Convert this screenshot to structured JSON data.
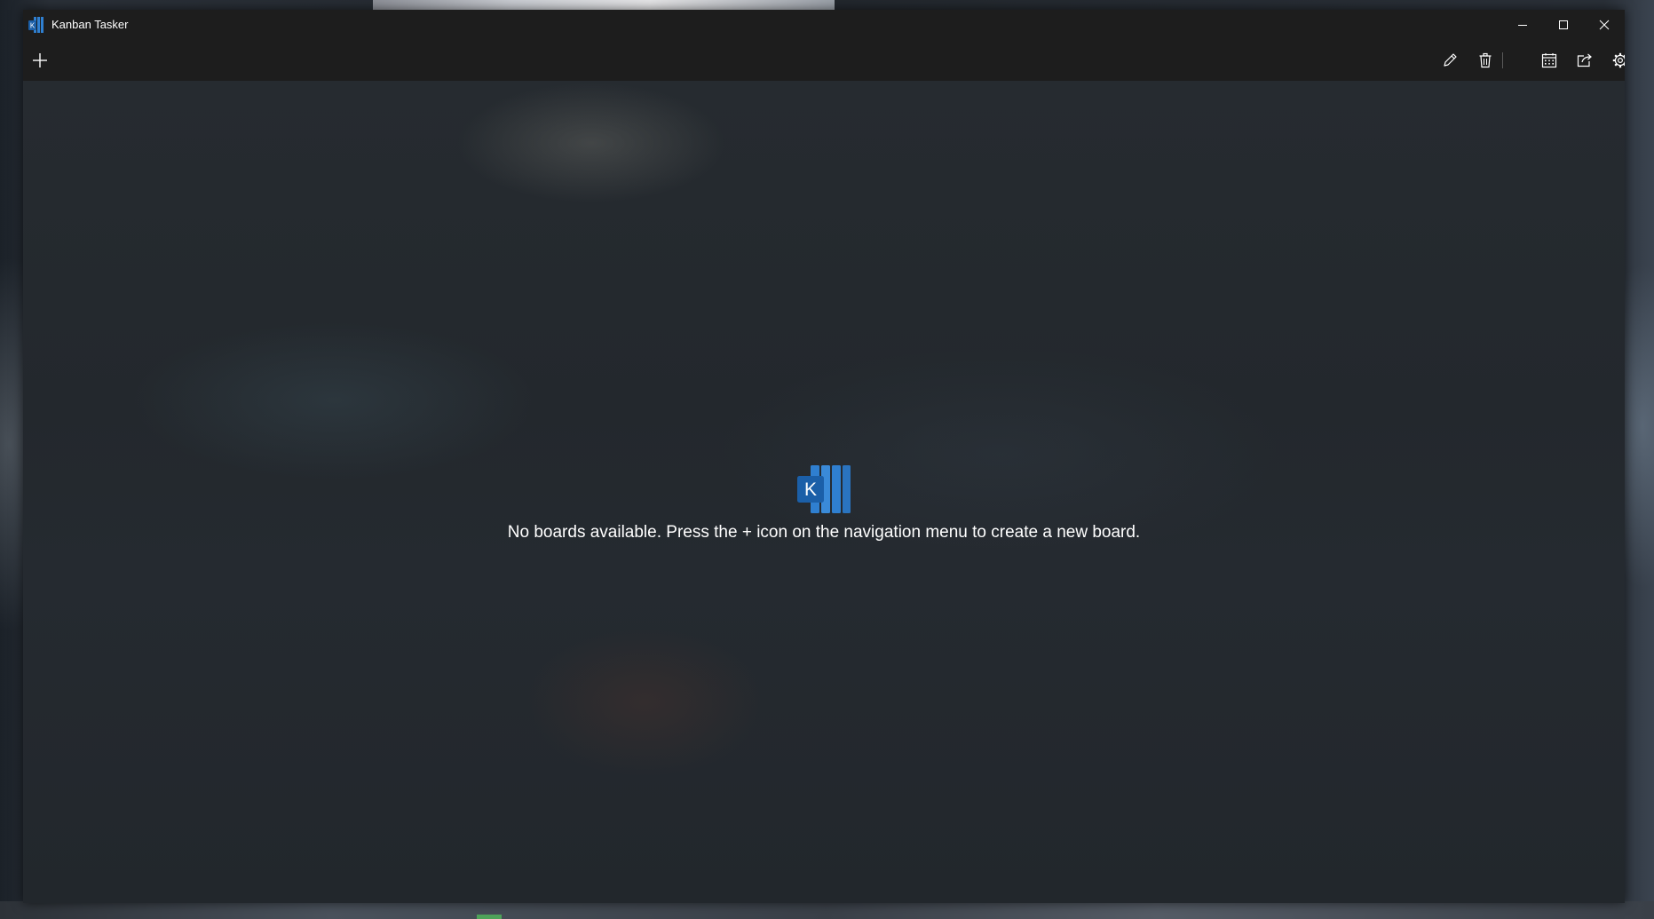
{
  "window": {
    "title": "Kanban Tasker"
  },
  "caption_buttons": {
    "minimize": "minimize-icon",
    "maximize": "maximize-icon",
    "close": "close-icon"
  },
  "toolbar": {
    "add": "plus-icon",
    "edit": "pencil-icon",
    "delete": "trash-icon",
    "calendar": "calendar-icon",
    "export": "share-icon",
    "settings": "gear-icon"
  },
  "empty_state": {
    "logo_letter": "K",
    "message": "No boards available. Press the + icon on the navigation menu to create a new board."
  },
  "colors": {
    "brand_blue": "#2f7fd0",
    "brand_dark_blue": "#1b5fa8",
    "titlebar": "#1d1d1d",
    "content_bg": "#23282d"
  }
}
